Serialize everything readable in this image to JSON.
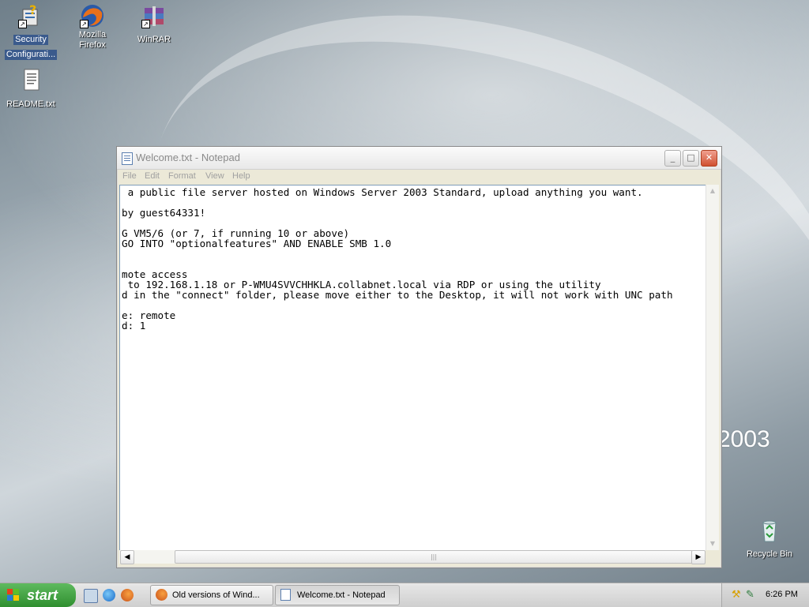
{
  "desktop": {
    "icons": [
      {
        "label_line1": "Security",
        "label_line2": "Configurati...",
        "icon": "security-configuration-icon"
      },
      {
        "label_line1": "Mozilla Firefox",
        "icon": "firefox-icon"
      },
      {
        "label_line1": "WinRAR",
        "icon": "winrar-icon"
      },
      {
        "label_line1": "README.txt",
        "icon": "text-file-icon"
      },
      {
        "label_line1": "Recycle Bin",
        "icon": "recycle-bin-icon"
      }
    ],
    "wallpaper_text": "2003"
  },
  "notepad": {
    "title": "Welcome.txt - Notepad",
    "menu": [
      "File",
      "Edit",
      "Format",
      "View",
      "Help"
    ],
    "content": " a public file server hosted on Windows Server 2003 Standard, upload anything you want.\n\nby guest64331!\n\nG VM5/6 (or 7, if running 10 or above)\nGO INTO \"optionalfeatures\" AND ENABLE SMB 1.0\n\n\nmote access\n to 192.168.1.18 or P-WMU4SVVCHHKLA.collabnet.local via RDP or using the utility\nd in the \"connect\" folder, please move either to the Desktop, it will not work with UNC path\n\ne: remote\nd: 1",
    "caption_buttons": {
      "minimize": "_",
      "maximize": "□",
      "close": "✕"
    }
  },
  "taskbar": {
    "start_label": "start",
    "quick_launch": [
      "show-desktop-icon",
      "internet-explorer-icon",
      "firefox-icon"
    ],
    "buttons": [
      {
        "label": "Old versions of Wind...",
        "icon": "firefox-icon",
        "active": false
      },
      {
        "label": "Welcome.txt - Notepad",
        "icon": "notepad-icon",
        "active": true
      }
    ],
    "clock": "6:26 PM"
  },
  "colors": {
    "start_green": "#3c9e3c",
    "close_red": "#d05030",
    "selection_blue": "#3a5a8c"
  }
}
